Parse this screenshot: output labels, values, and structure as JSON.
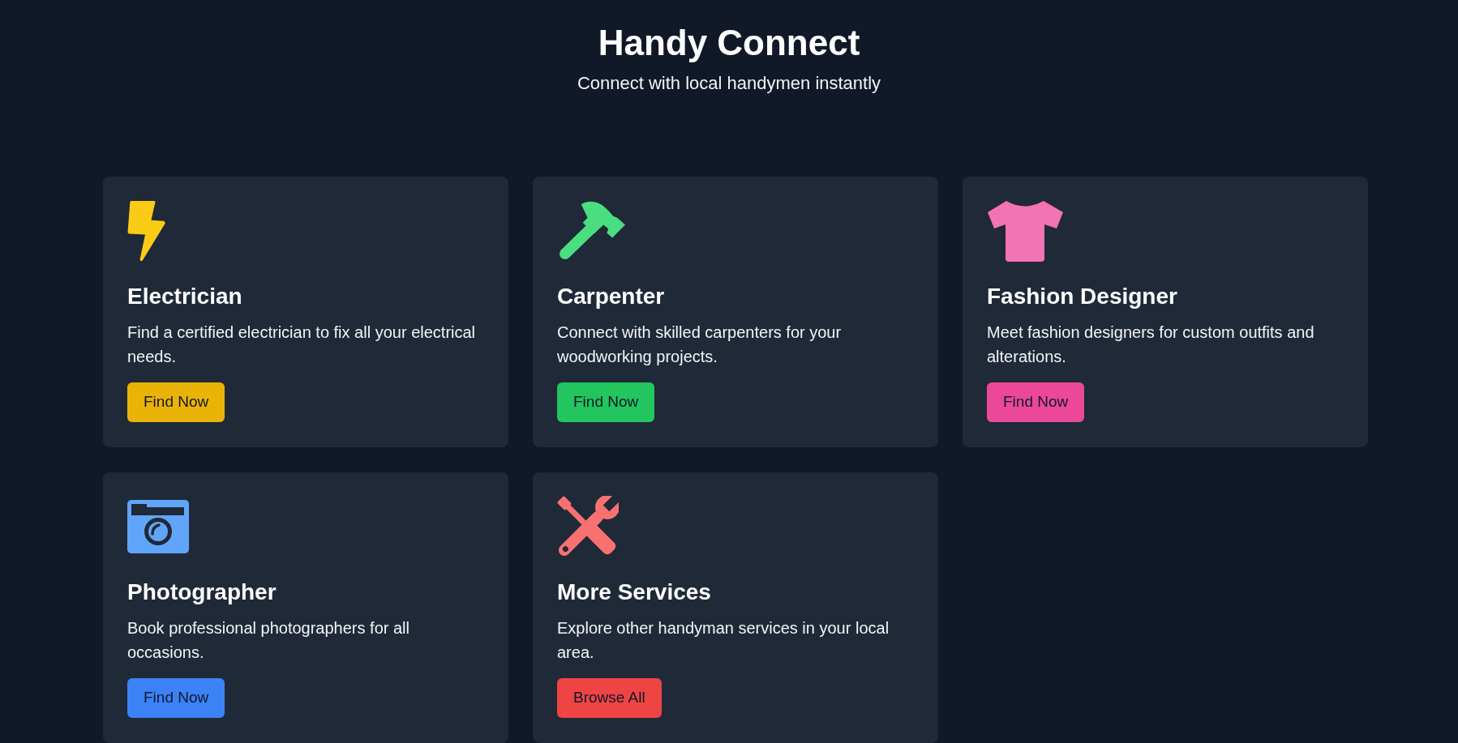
{
  "header": {
    "title": "Handy Connect",
    "subtitle": "Connect with local handymen instantly"
  },
  "services": [
    {
      "icon": {
        "color": "#facc15"
      },
      "title": "Electrician",
      "description": "Find a certified electrician to fix all your electrical needs.",
      "button": {
        "label": "Find Now",
        "color": "#eab308"
      }
    },
    {
      "icon": {
        "color": "#4ade80"
      },
      "title": "Carpenter",
      "description": "Connect with skilled carpenters for your woodworking projects.",
      "button": {
        "label": "Find Now",
        "color": "#22c55e"
      }
    },
    {
      "icon": {
        "color": "#f472b6"
      },
      "title": "Fashion Designer",
      "description": "Meet fashion designers for custom outfits and alterations.",
      "button": {
        "label": "Find Now",
        "color": "#ec4899"
      }
    },
    {
      "icon": {
        "color": "#60a5fa"
      },
      "title": "Photographer",
      "description": "Book professional photographers for all occasions.",
      "button": {
        "label": "Find Now",
        "color": "#3b82f6"
      }
    },
    {
      "icon": {
        "color": "#f87171"
      },
      "title": "More Services",
      "description": "Explore other handyman services in your local area.",
      "button": {
        "label": "Browse All",
        "color": "#ef4444"
      }
    }
  ]
}
